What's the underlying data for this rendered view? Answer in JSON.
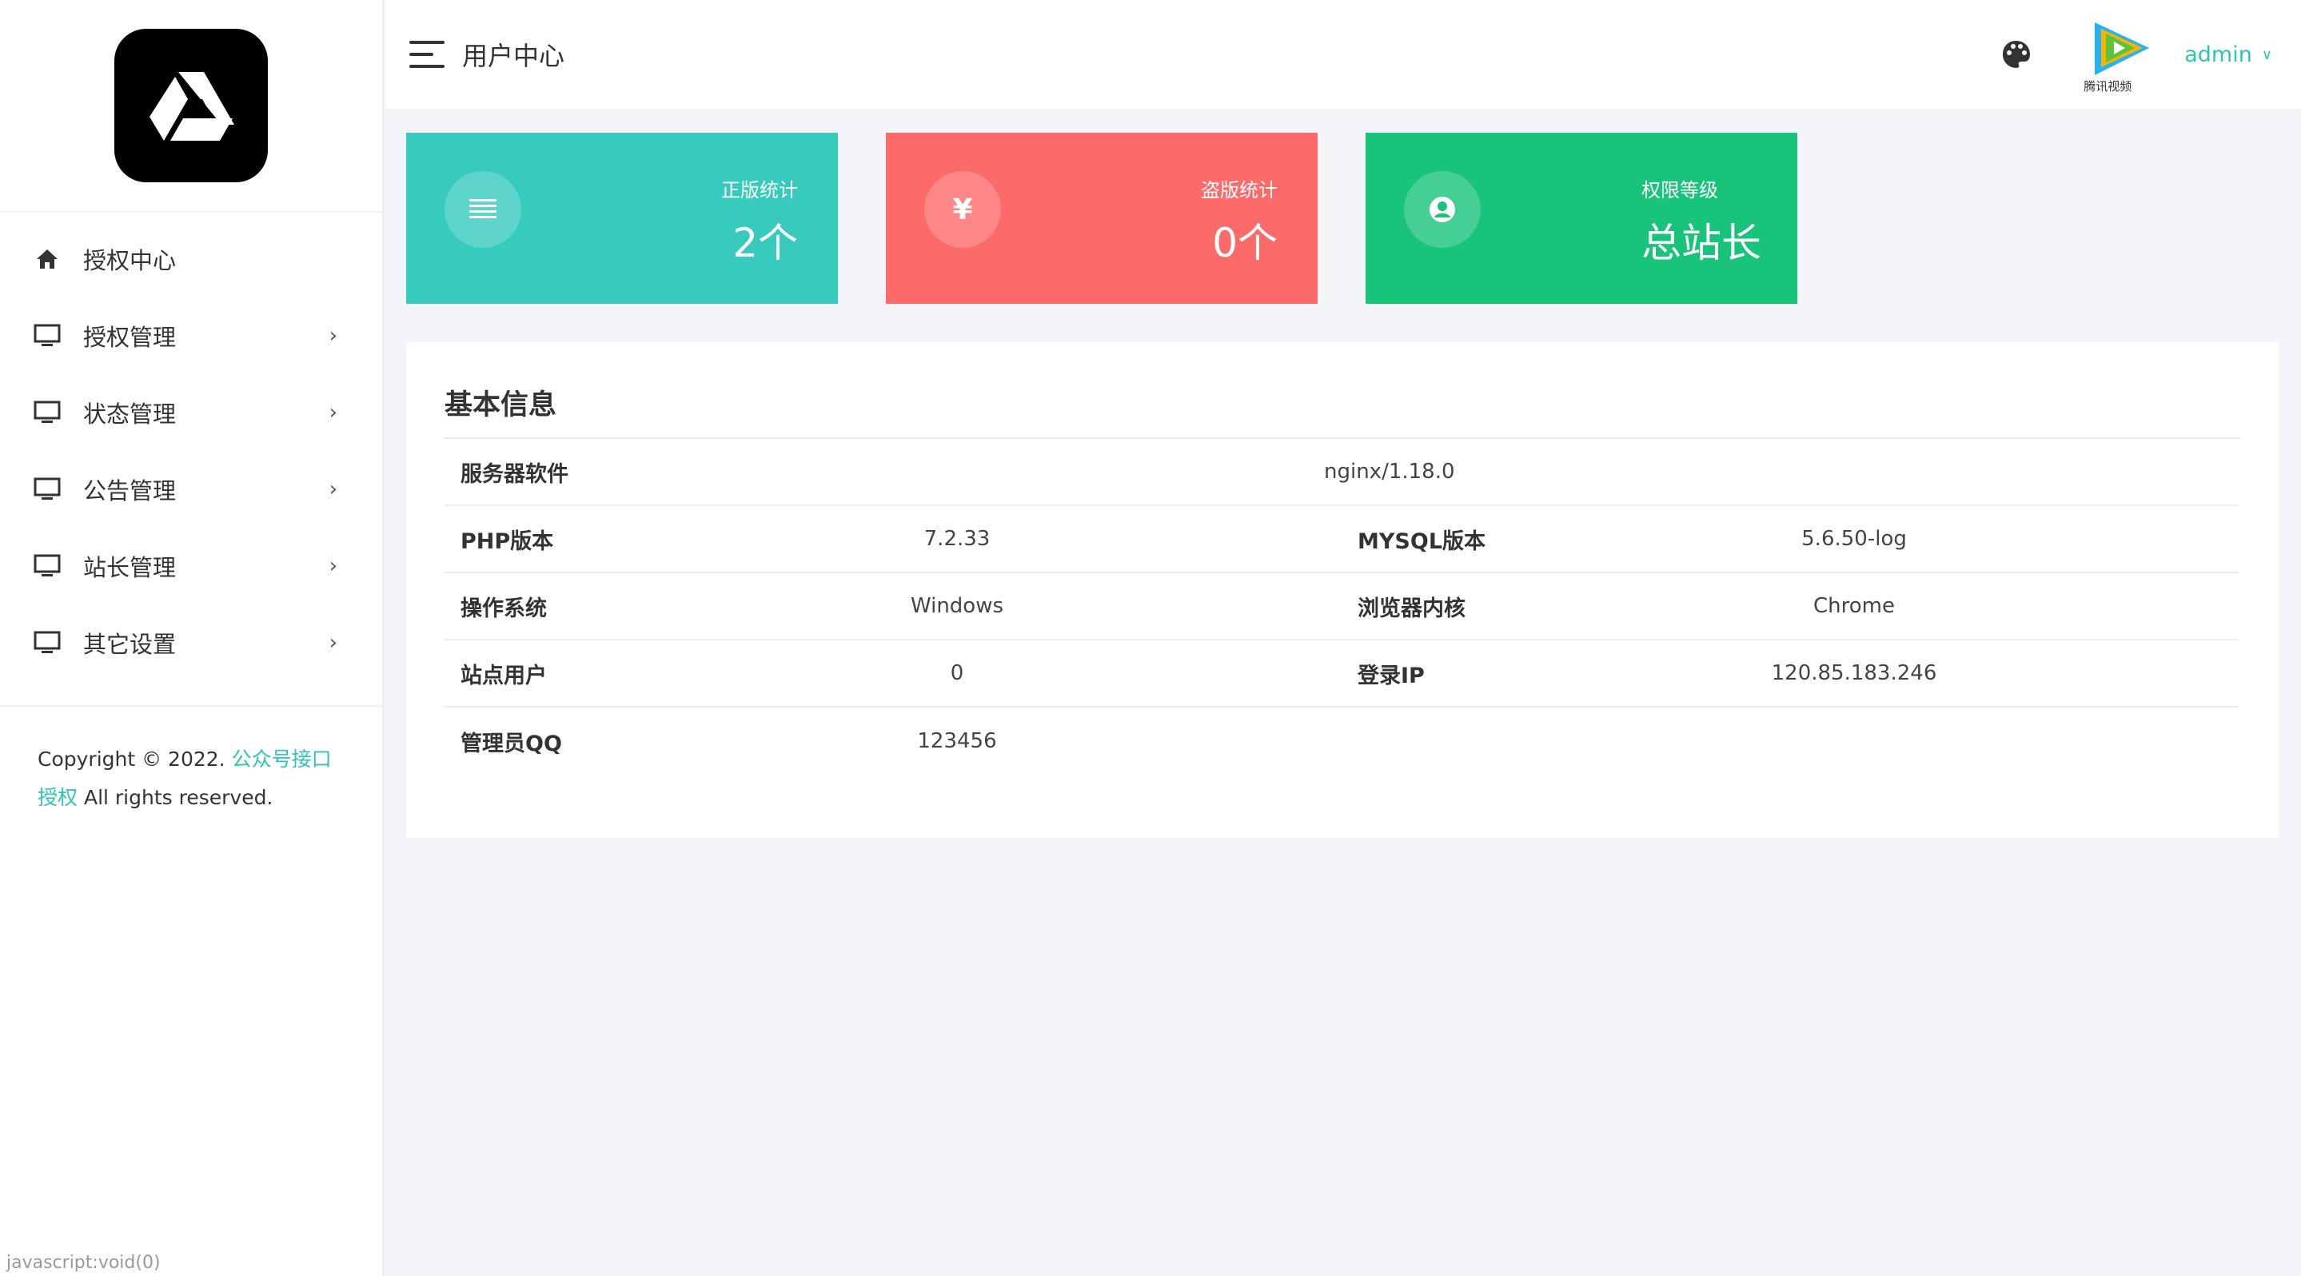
{
  "sidebar": {
    "items": [
      {
        "label": "授权中心",
        "icon": "home-icon",
        "has_chevron": false
      },
      {
        "label": "授权管理",
        "icon": "monitor-icon",
        "has_chevron": true
      },
      {
        "label": "状态管理",
        "icon": "monitor-icon",
        "has_chevron": true
      },
      {
        "label": "公告管理",
        "icon": "monitor-icon",
        "has_chevron": true
      },
      {
        "label": "站长管理",
        "icon": "monitor-icon",
        "has_chevron": true
      },
      {
        "label": "其它设置",
        "icon": "monitor-icon",
        "has_chevron": true
      }
    ],
    "copyright_prefix": "Copyright © 2022.",
    "copyright_link": "公众号接口授权",
    "copyright_suffix": " All rights reserved."
  },
  "header": {
    "title": "用户中心",
    "avatar_caption": "腾讯视频",
    "user": "admin"
  },
  "cards": [
    {
      "label": "正版统计",
      "value": "2个",
      "icon": "list-icon",
      "color": "#36cbbd"
    },
    {
      "label": "盗版统计",
      "value": "0个",
      "icon": "yen-icon",
      "color": "#fd6a6a"
    },
    {
      "label": "权限等级",
      "value": "总站长",
      "icon": "user-circle-icon",
      "color": "#18c37a"
    }
  ],
  "panel": {
    "title": "基本信息",
    "server_software": {
      "key": "服务器软件",
      "value": "nginx/1.18.0"
    },
    "php": {
      "key": "PHP版本",
      "value": "7.2.33"
    },
    "mysql": {
      "key": "MYSQL版本",
      "value": "5.6.50-log"
    },
    "os": {
      "key": "操作系统",
      "value": "Windows"
    },
    "browser": {
      "key": "浏览器内核",
      "value": "Chrome"
    },
    "users": {
      "key": "站点用户",
      "value": "0"
    },
    "login_ip": {
      "key": "登录IP",
      "value": "120.85.183.246"
    },
    "admin_qq": {
      "key": "管理员QQ",
      "value": "123456"
    }
  },
  "status_bar": "javascript:void(0)",
  "colors": {
    "accent": "#2ec4b6",
    "teal": "#36cbbd",
    "red": "#fd6a6a",
    "green": "#18c37a"
  }
}
